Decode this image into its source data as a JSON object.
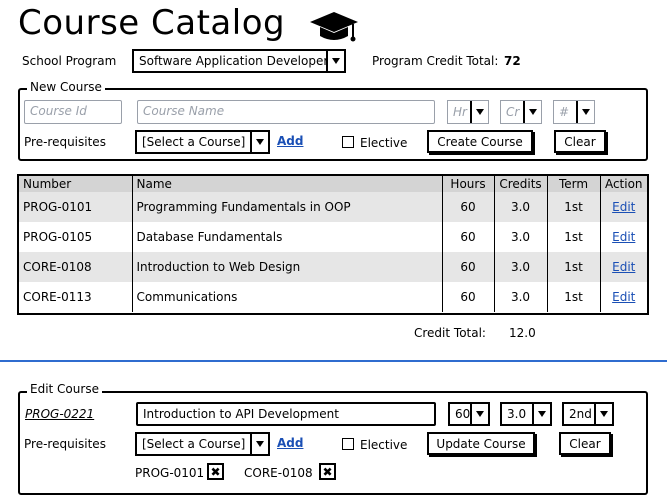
{
  "page": {
    "title": "Course Catalog"
  },
  "program": {
    "label": "School Program",
    "selected": "Software Application Developer",
    "credit_total_label": "Program Credit Total:",
    "credit_total_value": "72"
  },
  "new_course": {
    "legend": "New Course",
    "course_id_placeholder": "Course Id",
    "course_name_placeholder": "Course Name",
    "hours_placeholder": "Hr",
    "credits_placeholder": "Cr",
    "term_placeholder": "#",
    "prereq_label": "Pre-requisites",
    "prereq_selected": "[Select a Course]",
    "add_label": "Add",
    "elective_label": "Elective",
    "create_label": "Create Course",
    "clear_label": "Clear"
  },
  "table": {
    "headers": [
      "Number",
      "Name",
      "Hours",
      "Credits",
      "Term",
      "Action"
    ],
    "rows": [
      {
        "number": "PROG-0101",
        "name": "Programming Fundamentals in OOP",
        "hours": "60",
        "credits": "3.0",
        "term": "1st",
        "action": "Edit"
      },
      {
        "number": "PROG-0105",
        "name": "Database Fundamentals",
        "hours": "60",
        "credits": "3.0",
        "term": "1st",
        "action": "Edit"
      },
      {
        "number": "CORE-0108",
        "name": "Introduction to Web Design",
        "hours": "60",
        "credits": "3.0",
        "term": "1st",
        "action": "Edit"
      },
      {
        "number": "CORE-0113",
        "name": "Communications",
        "hours": "60",
        "credits": "3.0",
        "term": "1st",
        "action": "Edit"
      }
    ],
    "credit_total_label": "Credit Total:",
    "credit_total_value": "12.0"
  },
  "edit_course": {
    "legend": "Edit Course",
    "course_id": "PROG-0221",
    "course_name": "Introduction to API Development",
    "hours": "60",
    "credits": "3.0",
    "term": "2nd",
    "prereq_label": "Pre-requisites",
    "prereq_selected": "[Select a Course]",
    "add_label": "Add",
    "elective_label": "Elective",
    "update_label": "Update Course",
    "clear_label": "Clear",
    "prereqs": [
      "PROG-0101",
      "CORE-0108"
    ],
    "remove_glyph": "✖"
  },
  "colors": {
    "link": "#1a4fb5",
    "divider": "#2f6ccf",
    "header_bg": "#d4d4d4",
    "alt_row": "#e6e6e6",
    "placeholder": "#9aa0aa"
  },
  "icons": {
    "title_icon": "graduation-cap-icon",
    "remove": "remove-x-icon",
    "dropdown": "chevron-down-icon"
  }
}
